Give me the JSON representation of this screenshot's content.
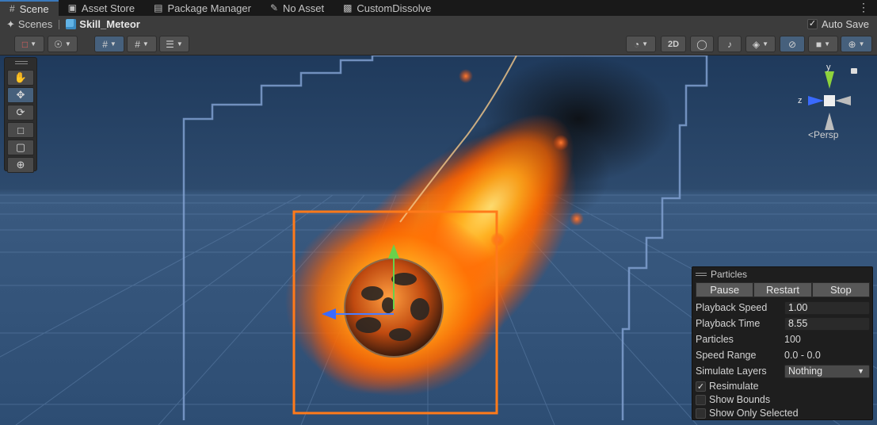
{
  "tabs": [
    {
      "label": "Scene",
      "icon": "grid-icon",
      "active": true
    },
    {
      "label": "Asset Store",
      "icon": "store-icon",
      "active": false
    },
    {
      "label": "Package Manager",
      "icon": "package-icon",
      "active": false
    },
    {
      "label": "No Asset",
      "icon": "asset-icon",
      "active": false
    },
    {
      "label": "CustomDissolve",
      "icon": "shader-icon",
      "active": false
    }
  ],
  "breadcrumb": {
    "root": "Scenes",
    "current": "Skill_Meteor"
  },
  "autosave": {
    "label": "Auto Save",
    "checked": true
  },
  "toolbar": {
    "mode_2d": "2D"
  },
  "view": {
    "projection": "Persp",
    "axes": {
      "y": "y",
      "z": "z"
    }
  },
  "particles": {
    "title": "Particles",
    "buttons": {
      "pause": "Pause",
      "restart": "Restart",
      "stop": "Stop"
    },
    "playback_speed": {
      "label": "Playback Speed",
      "value": "1.00"
    },
    "playback_time": {
      "label": "Playback Time",
      "value": "8.55"
    },
    "particles": {
      "label": "Particles",
      "value": "100"
    },
    "speed_range": {
      "label": "Speed Range",
      "value": "0.0 - 0.0"
    },
    "simulate_layers": {
      "label": "Simulate Layers",
      "value": "Nothing"
    },
    "resimulate": {
      "label": "Resimulate",
      "checked": true
    },
    "show_bounds": {
      "label": "Show Bounds",
      "checked": false
    },
    "show_only_selected": {
      "label": "Show Only Selected",
      "checked": false
    }
  },
  "colors": {
    "accent": "#3a79bb",
    "selection": "#ff7a1a",
    "sky": "#2a4566",
    "grid": "#5d7fa8"
  }
}
